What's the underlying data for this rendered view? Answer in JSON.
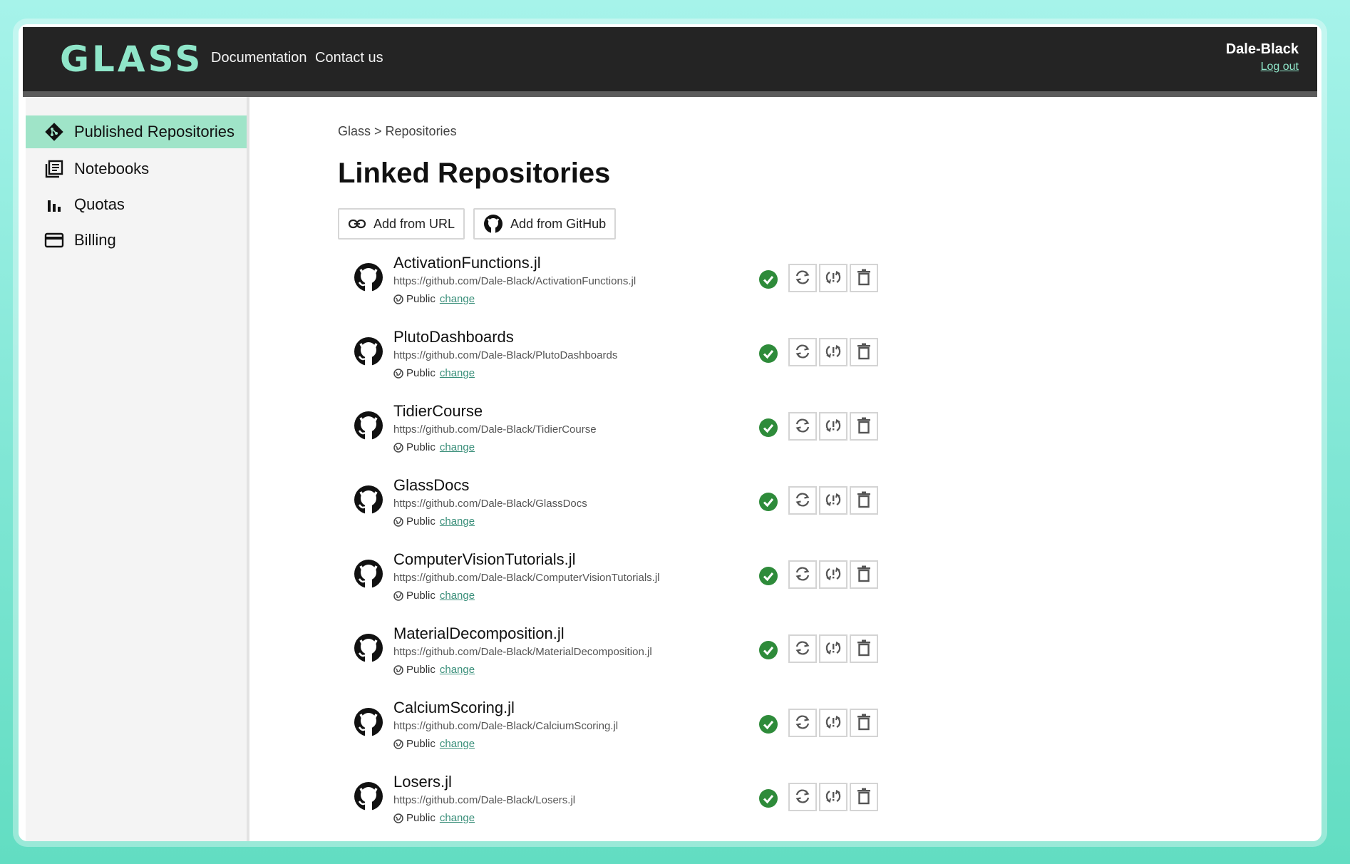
{
  "header": {
    "logo_text": "GLASS",
    "nav": [
      "Documentation",
      "Contact us"
    ],
    "username": "Dale-Black",
    "logout_label": "Log out"
  },
  "sidebar": {
    "items": [
      {
        "label": "Published Repositories",
        "icon": "git-diamond-icon",
        "active": true
      },
      {
        "label": "Notebooks",
        "icon": "notebook-icon",
        "active": false
      },
      {
        "label": "Quotas",
        "icon": "bar-chart-icon",
        "active": false
      },
      {
        "label": "Billing",
        "icon": "credit-card-icon",
        "active": false
      }
    ]
  },
  "main": {
    "breadcrumb": "Glass > Repositories",
    "title": "Linked Repositories",
    "buttons": {
      "add_url": "Add from URL",
      "add_github": "Add from GitHub"
    },
    "visibility_label": "Public",
    "change_label": "change",
    "repos": [
      {
        "name": "ActivationFunctions.jl",
        "url": "https://github.com/Dale-Black/ActivationFunctions.jl"
      },
      {
        "name": "PlutoDashboards",
        "url": "https://github.com/Dale-Black/PlutoDashboards"
      },
      {
        "name": "TidierCourse",
        "url": "https://github.com/Dale-Black/TidierCourse"
      },
      {
        "name": "GlassDocs",
        "url": "https://github.com/Dale-Black/GlassDocs"
      },
      {
        "name": "ComputerVisionTutorials.jl",
        "url": "https://github.com/Dale-Black/ComputerVisionTutorials.jl"
      },
      {
        "name": "MaterialDecomposition.jl",
        "url": "https://github.com/Dale-Black/MaterialDecomposition.jl"
      },
      {
        "name": "CalciumScoring.jl",
        "url": "https://github.com/Dale-Black/CalciumScoring.jl"
      },
      {
        "name": "Losers.jl",
        "url": "https://github.com/Dale-Black/Losers.jl"
      }
    ]
  },
  "colors": {
    "accent": "#9fe4c8",
    "header_bg": "#242424",
    "status_ok": "#2e8b3a",
    "link": "#3a8f7a"
  }
}
